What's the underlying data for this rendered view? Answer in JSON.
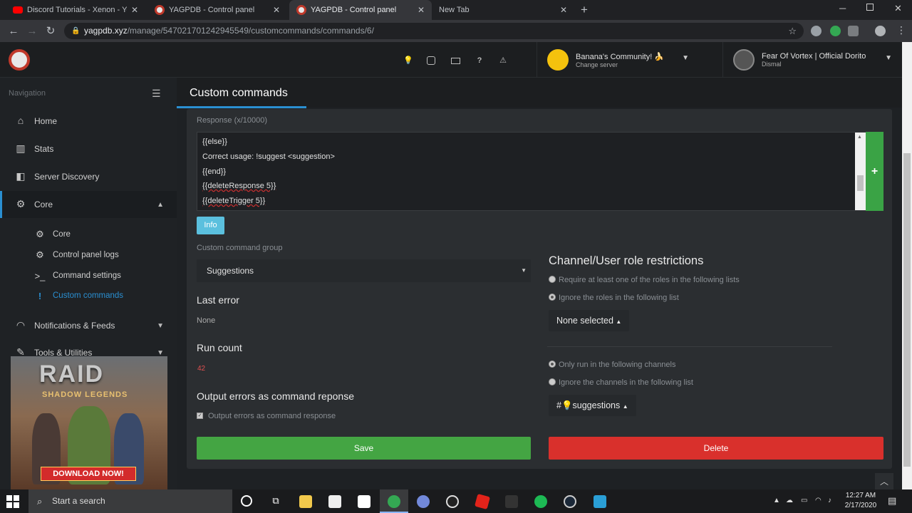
{
  "browser": {
    "tabs": [
      {
        "title": "Discord Tutorials - Xenon - YouTube",
        "fav_color": "#ff0000"
      },
      {
        "title": "YAGPDB - Control panel",
        "fav_color": "#c0392b"
      },
      {
        "title": "YAGPDB - Control panel",
        "fav_color": "#c0392b"
      },
      {
        "title": "New Tab",
        "fav_color": ""
      }
    ],
    "url_host": "yagpdb.xyz",
    "url_path": "/manage/547021701242945549/customcommands/commands/6/"
  },
  "header": {
    "server_name": "Banana's Community! 🍌",
    "server_sub": "Change server",
    "user_name": "Fear Of Vortex | Official Dorito",
    "user_sub": "Dismal"
  },
  "sidebar": {
    "nav_label": "Navigation",
    "items": [
      {
        "label": "Home"
      },
      {
        "label": "Stats"
      },
      {
        "label": "Server Discovery"
      },
      {
        "label": "Core"
      },
      {
        "label": "Notifications & Feeds"
      },
      {
        "label": "Tools & Utilities"
      }
    ],
    "core_sub": [
      {
        "label": "Core"
      },
      {
        "label": "Control panel logs"
      },
      {
        "label": "Command settings"
      },
      {
        "label": "Custom commands"
      }
    ]
  },
  "ad": {
    "title": "RAID",
    "subtitle": "SHADOW LEGENDS",
    "button": "DOWNLOAD NOW!"
  },
  "page": {
    "title": "Custom commands",
    "response_label": "Response (x/10000)",
    "code_lines": [
      "{{else}}",
      "Correct usage: !suggest <suggestion>",
      "{{end}}",
      "{{deleteResponse 5}}",
      "{{deleteTrigger 5}}"
    ],
    "info_button": "Info",
    "group_label": "Custom command group",
    "group_value": "Suggestions",
    "last_error_title": "Last error",
    "last_error_value": "None",
    "run_count_title": "Run count",
    "run_count_value": "42",
    "output_errors_title": "Output errors as command reponse",
    "output_errors_check": "Output errors as command response",
    "save_button": "Save",
    "delete_button": "Delete",
    "restrictions_title": "Channel/User role restrictions",
    "role_require": "Require at least one of the roles in the following lists",
    "role_ignore": "Ignore the roles in the following list",
    "roles_dropdown": "None selected",
    "chan_only": "Only run in the following channels",
    "chan_ignore": "Ignore the channels in the following list",
    "chan_dropdown": "#💡suggestions"
  },
  "taskbar": {
    "search": "Start a search",
    "time": "12:27 AM",
    "date": "2/17/2020"
  }
}
